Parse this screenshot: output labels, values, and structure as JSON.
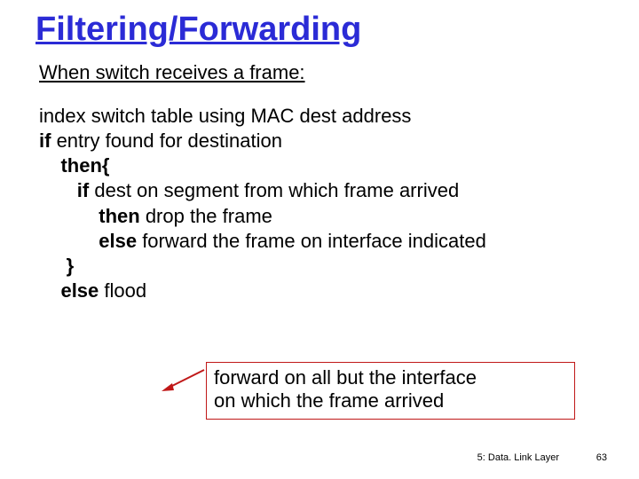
{
  "title": "Filtering/Forwarding",
  "subtitle": "When switch receives a frame:",
  "body": {
    "l1": "index switch table using MAC dest address",
    "l2a": "if",
    "l2b": " entry found for destination",
    "l3": "then{",
    "l4a": "if",
    "l4b": " dest on segment from which frame arrived",
    "l5a": "then",
    "l5b": " drop the frame",
    "l6a": "else",
    "l6b": " forward the frame on interface indicated",
    "l7": "}",
    "l8a": "else",
    "l8b": " flood"
  },
  "callout": {
    "line1": "forward on all but the interface",
    "line2": "on which the frame arrived"
  },
  "footer": {
    "chapter": "5: Data. Link Layer",
    "page": "63"
  },
  "colors": {
    "title": "#2b2bd6",
    "callout_border": "#c01818",
    "arrow": "#c01818"
  }
}
